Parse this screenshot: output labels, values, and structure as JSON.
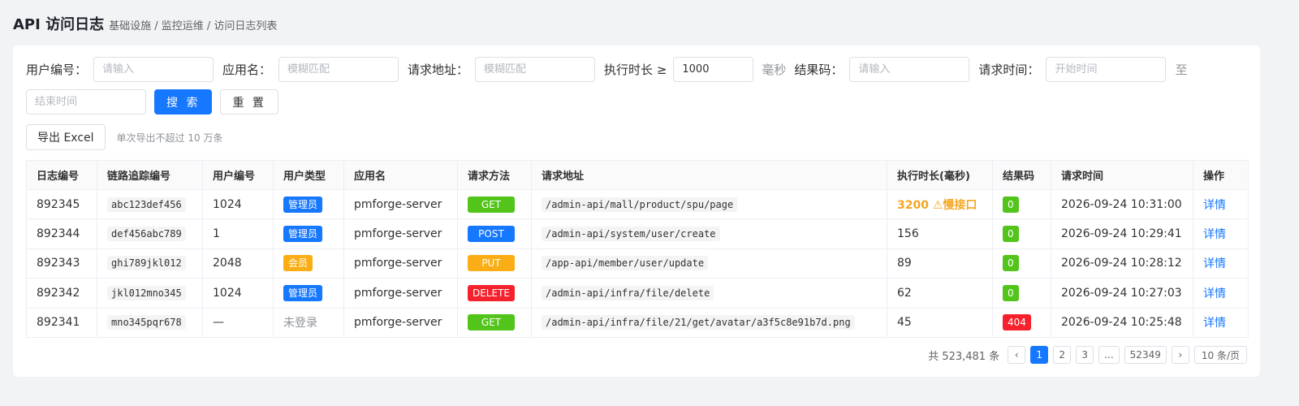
{
  "page": {
    "title": "API 访问日志",
    "breadcrumb": "基础设施 / 监控运维 / 访问日志列表"
  },
  "filters": {
    "user_id": {
      "label": "用户编号：",
      "placeholder": "请输入",
      "value": ""
    },
    "app_name": {
      "label": "应用名：",
      "placeholder": "模糊匹配",
      "value": ""
    },
    "request_url": {
      "label": "请求地址：",
      "placeholder": "模糊匹配",
      "value": ""
    },
    "duration": {
      "label": "执行时长 ≥",
      "value": "1000",
      "unit": "毫秒"
    },
    "result_code": {
      "label": "结果码：",
      "placeholder": "请输入",
      "value": ""
    },
    "request_time": {
      "label": "请求时间：",
      "start_placeholder": "开始时间",
      "separator": "至",
      "end_placeholder": "结束时间"
    },
    "search_label": "搜 索",
    "reset_label": "重 置"
  },
  "export": {
    "button_label": "导出 Excel",
    "hint": "单次导出不超过 10 万条"
  },
  "table": {
    "columns": [
      "日志编号",
      "链路追踪编号",
      "用户编号",
      "用户类型",
      "应用名",
      "请求方法",
      "请求地址",
      "执行时长(毫秒)",
      "结果码",
      "请求时间",
      "操作"
    ],
    "rows": [
      {
        "id": "892345",
        "trace": "abc123def456",
        "user_id": "1024",
        "user_type": "管理员",
        "user_type_color": "#1677ff",
        "app": "pmforge-server",
        "method": "GET",
        "method_color": "#52c41a",
        "url": "/admin-api/mall/product/spu/page",
        "duration": "3200 ⚠慢接口",
        "duration_slow": true,
        "code": "0",
        "code_color": "#52c41a",
        "time": "2026-09-24 10:31:00",
        "action": "详情"
      },
      {
        "id": "892344",
        "trace": "def456abc789",
        "user_id": "1",
        "user_type": "管理员",
        "user_type_color": "#1677ff",
        "app": "pmforge-server",
        "method": "POST",
        "method_color": "#1677ff",
        "url": "/admin-api/system/user/create",
        "duration": "156",
        "duration_slow": false,
        "code": "0",
        "code_color": "#52c41a",
        "time": "2026-09-24 10:29:41",
        "action": "详情"
      },
      {
        "id": "892343",
        "trace": "ghi789jkl012",
        "user_id": "2048",
        "user_type": "会员",
        "user_type_color": "#faad14",
        "app": "pmforge-server",
        "method": "PUT",
        "method_color": "#faad14",
        "url": "/app-api/member/user/update",
        "duration": "89",
        "duration_slow": false,
        "code": "0",
        "code_color": "#52c41a",
        "time": "2026-09-24 10:28:12",
        "action": "详情"
      },
      {
        "id": "892342",
        "trace": "jkl012mno345",
        "user_id": "1024",
        "user_type": "管理员",
        "user_type_color": "#1677ff",
        "app": "pmforge-server",
        "method": "DELETE",
        "method_color": "#f5222d",
        "url": "/admin-api/infra/file/delete",
        "duration": "62",
        "duration_slow": false,
        "code": "0",
        "code_color": "#52c41a",
        "time": "2026-09-24 10:27:03",
        "action": "详情"
      },
      {
        "id": "892341",
        "trace": "mno345pqr678",
        "user_id": "—",
        "user_type": "未登录",
        "user_type_color": "",
        "app": "pmforge-server",
        "method": "GET",
        "method_color": "#52c41a",
        "url": "/admin-api/infra/file/21/get/avatar/a3f5c8e91b7d.png",
        "duration": "45",
        "duration_slow": false,
        "code": "404",
        "code_color": "#f5222d",
        "time": "2026-09-24 10:25:48",
        "action": "详情"
      }
    ]
  },
  "pagination": {
    "total": "共 523,481 条",
    "prev": "‹",
    "next": "›",
    "pages": [
      "1",
      "2",
      "3",
      "...",
      "52349"
    ],
    "current": "1",
    "page_size": "10 条/页"
  }
}
